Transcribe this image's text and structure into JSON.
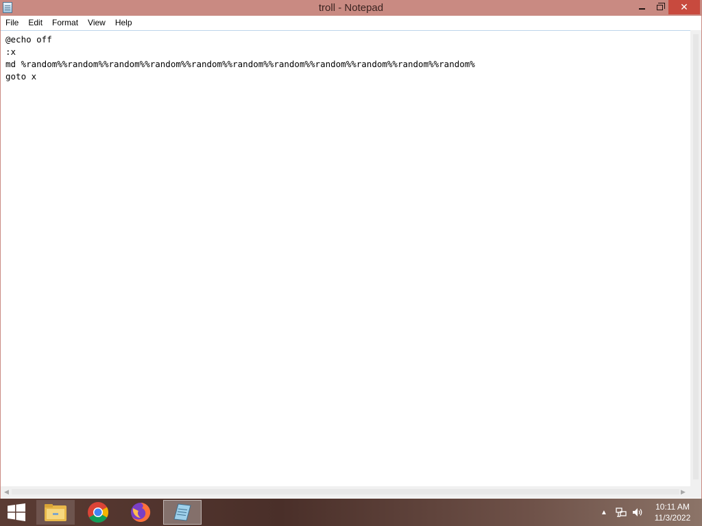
{
  "window": {
    "title": "troll - Notepad",
    "close_glyph": "✕"
  },
  "menu": [
    {
      "label": "File"
    },
    {
      "label": "Edit"
    },
    {
      "label": "Format"
    },
    {
      "label": "View"
    },
    {
      "label": "Help"
    }
  ],
  "editor": {
    "lines": [
      "@echo off",
      ":x",
      "md %random%%random%%random%%random%%random%%random%%random%%random%%random%%random%%random%",
      "goto x"
    ]
  },
  "taskbar": {
    "apps": [
      {
        "name": "File Explorer",
        "icon": "folder-icon"
      },
      {
        "name": "Google Chrome",
        "icon": "chrome-icon"
      },
      {
        "name": "Firefox",
        "icon": "firefox-icon"
      },
      {
        "name": "Notepad",
        "icon": "notepad-icon",
        "active": true
      }
    ],
    "tray_up_glyph": "▲",
    "clock": {
      "time": "10:11 AM",
      "date": "11/3/2022"
    }
  },
  "colors": {
    "titlebar": "#c98a82",
    "close_button": "#c84a3e",
    "taskbar": "#5a3b33"
  }
}
